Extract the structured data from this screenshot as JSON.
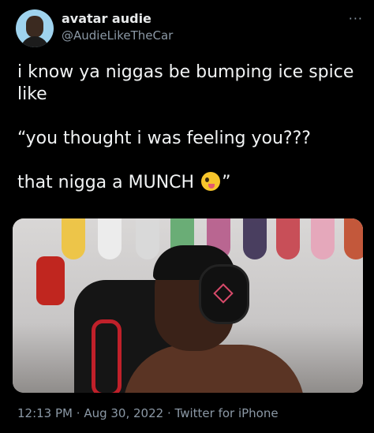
{
  "author": {
    "display_name": "avatar audie",
    "handle": "@AudieLikeTheCar"
  },
  "more_icon": "···",
  "tweet": {
    "line1": "i know ya niggas be bumping ice spice like",
    "line2": "“you thought i was feeling you???",
    "line3_prefix": "that nigga a MUNCH",
    "line3_emoji": "zany-face-emoji",
    "line3_suffix": "”"
  },
  "media": {
    "type": "video-still",
    "icon": "video-frame"
  },
  "meta": {
    "time": "12:13 PM",
    "date": "Aug 30, 2022",
    "source": "Twitter for iPhone",
    "separator": "·"
  },
  "colors": {
    "background": "#000000",
    "text_primary": "#e7e9ea",
    "text_secondary": "#8b98a5"
  }
}
